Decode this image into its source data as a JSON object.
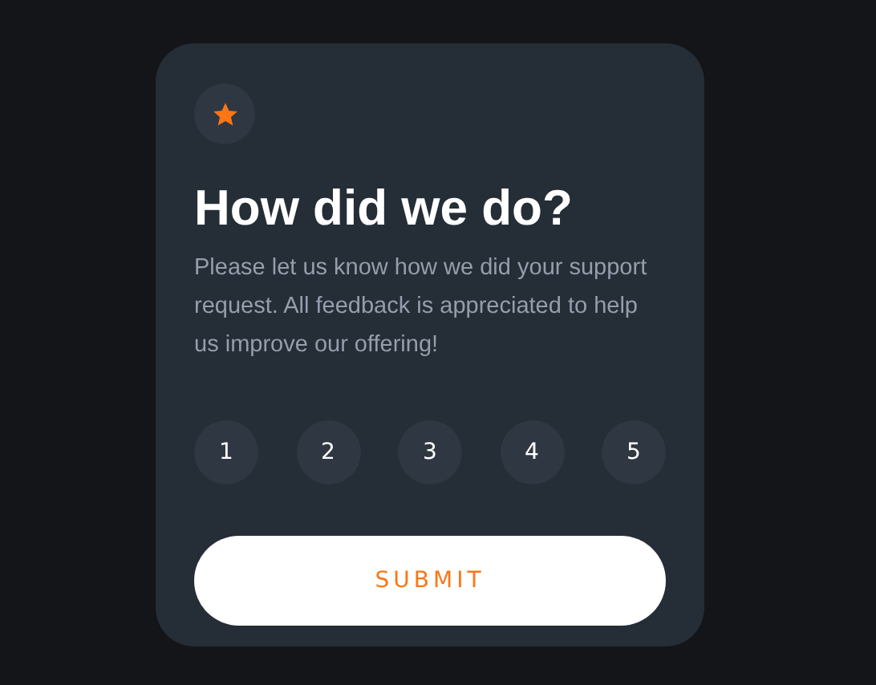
{
  "card": {
    "title": "How did we do?",
    "description": "Please let us know how we did your support request. All feedback is appreciated to help us improve our offering!",
    "ratings": [
      {
        "label": "1",
        "selected": false
      },
      {
        "label": "2",
        "selected": false
      },
      {
        "label": "3",
        "selected": false
      },
      {
        "label": "4",
        "selected": false
      },
      {
        "label": "5",
        "selected": false
      }
    ],
    "submit": "SUBMIT"
  }
}
